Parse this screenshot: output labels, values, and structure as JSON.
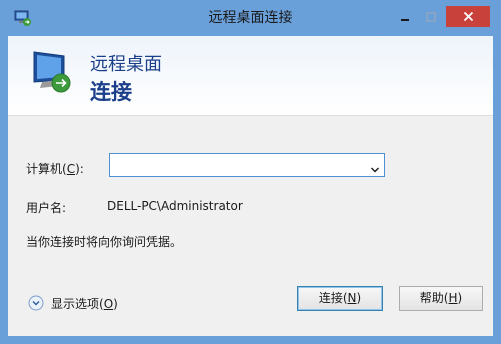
{
  "window": {
    "title": "远程桌面连接",
    "title_icon": "remote-desktop-icon",
    "minimize_glyph": "—",
    "maximize_glyph": "☐",
    "close_glyph": "✕",
    "close_color": "#c8423b",
    "frame_color": "#6aa0d9"
  },
  "banner": {
    "line1": "远程桌面",
    "line2": "连接",
    "text_color": "#1b3f8a"
  },
  "form": {
    "computer_label_pre": "计算机(",
    "computer_label_key": "C",
    "computer_label_post": "):",
    "computer_value": "",
    "username_label": "用户名:",
    "username_value": "DELL-PC\\Administrator",
    "note": "当你连接时将向你询问凭据。"
  },
  "footer": {
    "options_pre": "显示选项(",
    "options_key": "O",
    "options_post": ")",
    "connect_pre": "连接(",
    "connect_key": "N",
    "connect_post": ")",
    "help_pre": "帮助(",
    "help_key": "H",
    "help_post": ")"
  }
}
